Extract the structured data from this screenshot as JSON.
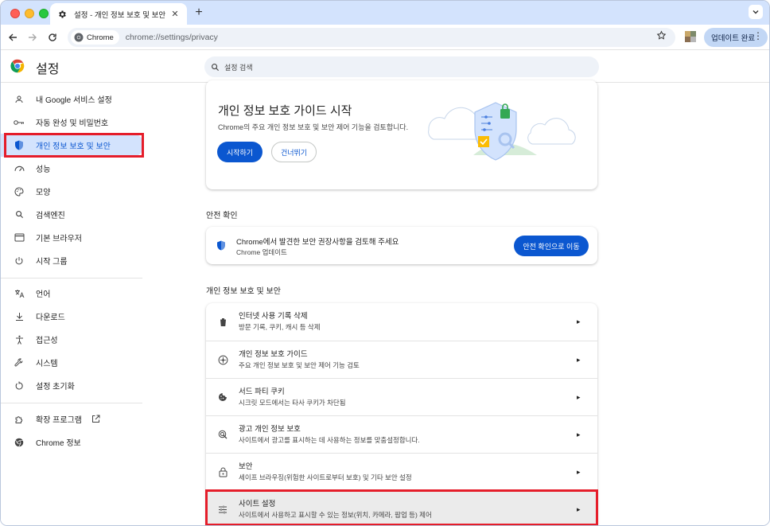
{
  "browser": {
    "tab_title": "설정 - 개인 정보 보호 및 보안",
    "new_tab": "+",
    "chip_label": "Chrome",
    "url": "chrome://settings/privacy",
    "update_button": "업데이트 완료"
  },
  "header": {
    "title": "설정",
    "search_placeholder": "설정 검색"
  },
  "sidebar": {
    "items": [
      {
        "label": "내 Google 서비스 설정",
        "icon": "person-icon"
      },
      {
        "label": "자동 완성 및 비밀번호",
        "icon": "key-icon"
      },
      {
        "label": "개인 정보 보호 및 보안",
        "icon": "shield-icon"
      },
      {
        "label": "성능",
        "icon": "speedometer-icon"
      },
      {
        "label": "모양",
        "icon": "palette-icon"
      },
      {
        "label": "검색엔진",
        "icon": "search-icon"
      },
      {
        "label": "기본 브라우저",
        "icon": "browser-icon"
      },
      {
        "label": "시작 그룹",
        "icon": "power-icon"
      },
      {
        "label": "언어",
        "icon": "translate-icon"
      },
      {
        "label": "다운로드",
        "icon": "download-icon"
      },
      {
        "label": "접근성",
        "icon": "accessibility-icon"
      },
      {
        "label": "시스템",
        "icon": "wrench-icon"
      },
      {
        "label": "설정 초기화",
        "icon": "reset-icon"
      },
      {
        "label": "확장 프로그램",
        "icon": "puzzle-icon"
      },
      {
        "label": "Chrome 정보",
        "icon": "chrome-icon"
      }
    ],
    "active_index": 2
  },
  "guide": {
    "title": "개인 정보 보호 가이드 시작",
    "desc": "Chrome의 주요 개인 정보 보호 및 보안 제어 기능을 검토합니다.",
    "start_button": "시작하기",
    "skip_button": "건너뛰기"
  },
  "safety": {
    "section_label": "안전 확인",
    "title": "Chrome에서 발견한 보안 권장사항을 검토해 주세요",
    "subtitle": "Chrome 업데이트",
    "button": "안전 확인으로 이동"
  },
  "privacy": {
    "section_label": "개인 정보 보호 및 보안",
    "rows": [
      {
        "title": "인터넷 사용 기록 삭제",
        "subtitle": "방문 기록, 쿠키, 캐시 등 삭제",
        "icon": "trash-icon"
      },
      {
        "title": "개인 정보 보호 가이드",
        "subtitle": "주요 개인 정보 보호 및 보안 제어 기능 검토",
        "icon": "compass-icon"
      },
      {
        "title": "서드 파티 쿠키",
        "subtitle": "시크릿 모드에서는 타사 쿠키가 차단됨",
        "icon": "cookie-icon"
      },
      {
        "title": "광고 개인 정보 보호",
        "subtitle": "사이트에서 광고를 표시하는 데 사용하는 정보를 맞춤설정합니다.",
        "icon": "ad-privacy-icon"
      },
      {
        "title": "보안",
        "subtitle": "세이프 브라우징(위험한 사이트로부터 보호) 및 기타 보안 설정",
        "icon": "lock-icon"
      },
      {
        "title": "사이트 설정",
        "subtitle": "사이트에서 사용하고 표시할 수 있는 정보(위치, 카메라, 팝업 등) 제어",
        "icon": "tune-icon"
      }
    ]
  },
  "colors": {
    "accent": "#0b57d0",
    "highlight": "#e51d2a",
    "active_bg": "#d3e3fd"
  }
}
